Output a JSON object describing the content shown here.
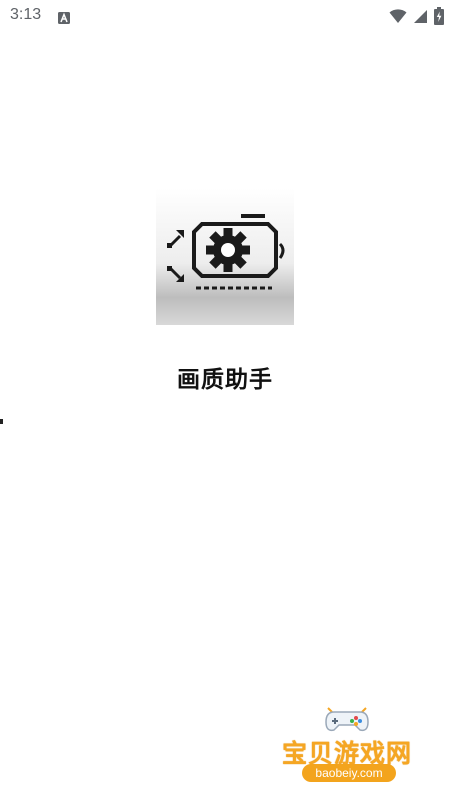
{
  "status_bar": {
    "time": "3:13",
    "notification_icon": "android-a-icon",
    "icons": [
      "wifi-icon",
      "cell-signal-icon",
      "battery-icon"
    ]
  },
  "splash": {
    "app_icon": "gpu-settings-icon",
    "app_name": "画质助手"
  },
  "watermark": {
    "title": "宝贝游戏网",
    "url": "baobeiy.com",
    "icon": "gamepad-icon",
    "accent": "#f5a623"
  },
  "colors": {
    "background": "#ffffff",
    "status_text": "#5f6368",
    "title_text": "#111111"
  }
}
